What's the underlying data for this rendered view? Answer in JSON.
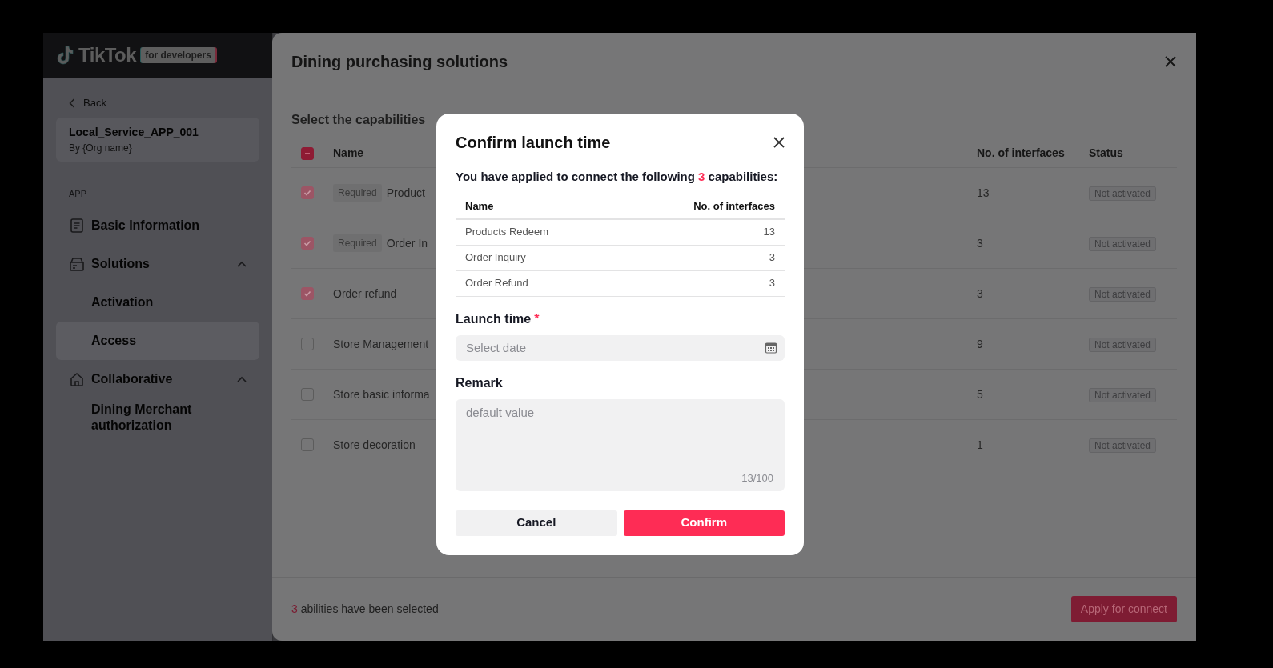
{
  "header": {
    "logo": "TikTok",
    "badge": "for developers"
  },
  "sidebar": {
    "back": "Back",
    "app_name": "Local_Service_APP_001",
    "app_org": "By {Org name}",
    "section": "APP",
    "items": [
      {
        "label": "Basic Information",
        "selected": false
      },
      {
        "label": "Solutions",
        "expanded": true,
        "children": [
          {
            "label": "Activation",
            "selected": false
          },
          {
            "label": "Access",
            "selected": true
          }
        ]
      },
      {
        "label": "Collaborative",
        "expanded": true,
        "children": [
          {
            "label": "Dining Merchant authorization",
            "selected": false
          }
        ]
      }
    ]
  },
  "drawer": {
    "title": "Dining purchasing solutions",
    "subtitle": "Select the capabilities",
    "select_all": {
      "indeterminate": true
    },
    "columns": [
      "Name",
      "No. of interfaces",
      "Status"
    ],
    "rows": [
      {
        "checked": true,
        "disabled": true,
        "tag": "Required",
        "name": "Product",
        "interfaces": "13",
        "status": "Not activated"
      },
      {
        "checked": true,
        "disabled": true,
        "tag": "Required",
        "name": "Order In",
        "interfaces": "3",
        "status": "Not activated"
      },
      {
        "checked": true,
        "disabled": true,
        "name": "Order refund",
        "interfaces": "3",
        "status": "Not activated"
      },
      {
        "checked": false,
        "disabled": false,
        "name": "Store Management",
        "interfaces": "9",
        "status": "Not activated"
      },
      {
        "checked": false,
        "disabled": false,
        "name": "Store basic informa",
        "interfaces": "5",
        "status": "Not activated"
      },
      {
        "checked": false,
        "disabled": false,
        "name": "Store decoration",
        "interfaces": "1",
        "status": "Not activated"
      }
    ],
    "footer": {
      "count": "3",
      "text": "abilities have been selected",
      "button": "Apply for connect"
    }
  },
  "modal": {
    "title": "Confirm launch time",
    "intro_before": "You have applied to connect the following",
    "count": "3",
    "intro_after": "capabilities:",
    "columns": [
      "Name",
      "No. of interfaces"
    ],
    "rows": [
      {
        "name": "Products Redeem",
        "interfaces": "13"
      },
      {
        "name": "Order Inquiry",
        "interfaces": "3"
      },
      {
        "name": "Order Refund",
        "interfaces": "3"
      }
    ],
    "launch_label": "Launch time",
    "required_mark": "*",
    "date_placeholder": "Select date",
    "remark_label": "Remark",
    "remark_placeholder": "default value",
    "counter": "13/100",
    "cancel": "Cancel",
    "confirm": "Confirm"
  }
}
